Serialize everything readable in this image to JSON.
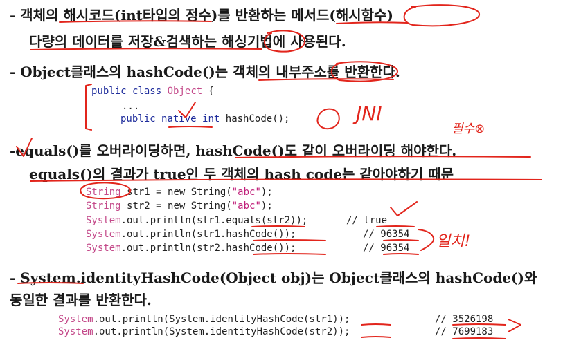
{
  "prose": {
    "l1": "- 객체의 해시코드(int타입의 정수)를 반환하는 메서드(해시함수)",
    "l2": "다량의 데이터를 저장&검색하는 해싱기법에 사용된다.",
    "l3": "- Object클래스의 hashCode()는 객체의 내부주소를 반환한다.",
    "l4": "-equals()를 오버라이딩하면, hashCode()도 같이 오버라이딩 해야한다.",
    "l5": "equals()의 결과가 true인 두 객체의 hash code는 같아야하기 때문",
    "l6": "- System.identityHashCode(Object obj)는 Object클래스의 hashCode()와",
    "l7": "동일한 결과를 반환한다."
  },
  "code1": {
    "kw_public": "public",
    "kw_class": "class",
    "type_object": "Object",
    "brace": " {",
    "dots": "...",
    "kw_public2": "public",
    "kw_native": "native",
    "kw_int": "int",
    "method": "hashCode();"
  },
  "code2": {
    "type_string": "String",
    "s1_rest": "str1 = new String(",
    "s1_lit": "\"abc\"",
    "s1_end": ");",
    "s2_rest": "str2 = new String(",
    "s2_lit": "\"abc\"",
    "s2_end": ");",
    "sys": "System",
    "call_equals": ".out.println(str1.equals(str2));",
    "c_true": "// true",
    "call_h1": ".out.println(str1.hashCode());",
    "c_h1": "// 96354",
    "call_h2": ".out.println(str2.hashCode());",
    "c_h2": "// 96354"
  },
  "code3": {
    "sys": "System",
    "call_1": ".out.println(System.identityHashCode(str1));",
    "c_1": "// 3526198",
    "call_2": ".out.println(System.identityHashCode(str2));",
    "c_2": "// 7699183"
  },
  "annotations": {
    "jni": "JNI",
    "pilsu": "필수⊗",
    "ilchi": "일치!"
  },
  "colors": {
    "ink": "#e2251c",
    "keyword": "#1f2d9c",
    "string": "#c0207a",
    "comment": "#2e8a2e"
  }
}
